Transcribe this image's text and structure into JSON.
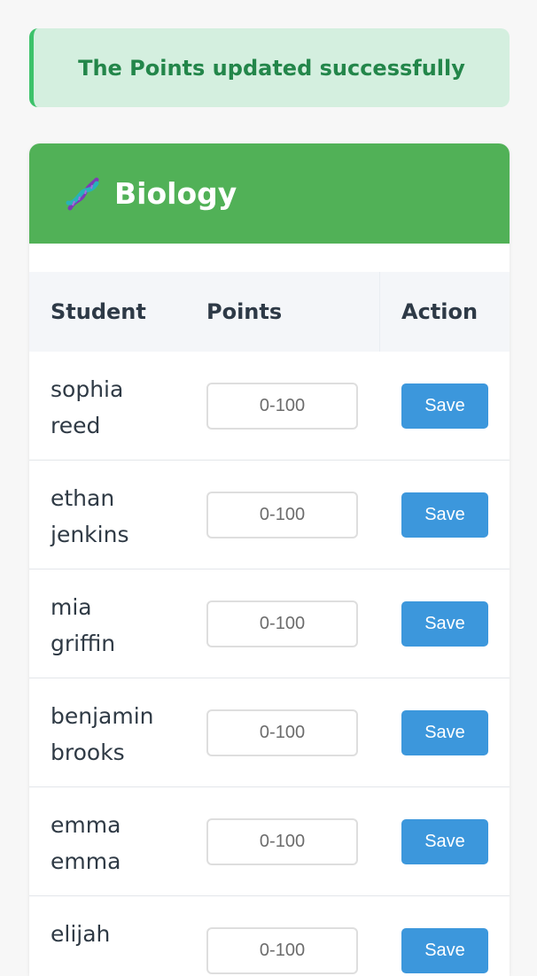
{
  "alert": {
    "message": "The Points updated successfully"
  },
  "card": {
    "title": "Biology",
    "icon": "dna-icon",
    "header_color": "#51b157"
  },
  "table": {
    "headers": {
      "student": "Student",
      "points": "Points",
      "action": "Action"
    },
    "rows": [
      {
        "first": "sophia",
        "last": "reed",
        "points_value": "",
        "points_placeholder": "0-100",
        "action_label": "Save"
      },
      {
        "first": "ethan",
        "last": "jenkins",
        "points_value": "",
        "points_placeholder": "0-100",
        "action_label": "Save"
      },
      {
        "first": "mia",
        "last": "griffin",
        "points_value": "",
        "points_placeholder": "0-100",
        "action_label": "Save"
      },
      {
        "first": "benjamin",
        "last": "brooks",
        "points_value": "",
        "points_placeholder": "0-100",
        "action_label": "Save"
      },
      {
        "first": "emma",
        "last": "emma",
        "points_value": "",
        "points_placeholder": "0-100",
        "action_label": "Save"
      },
      {
        "first": "elijah",
        "last": "",
        "points_value": "",
        "points_placeholder": "0-100",
        "action_label": "Save"
      }
    ]
  },
  "colors": {
    "alert_bg": "#d4efdf",
    "alert_text": "#23864a",
    "button": "#3c97dc"
  }
}
